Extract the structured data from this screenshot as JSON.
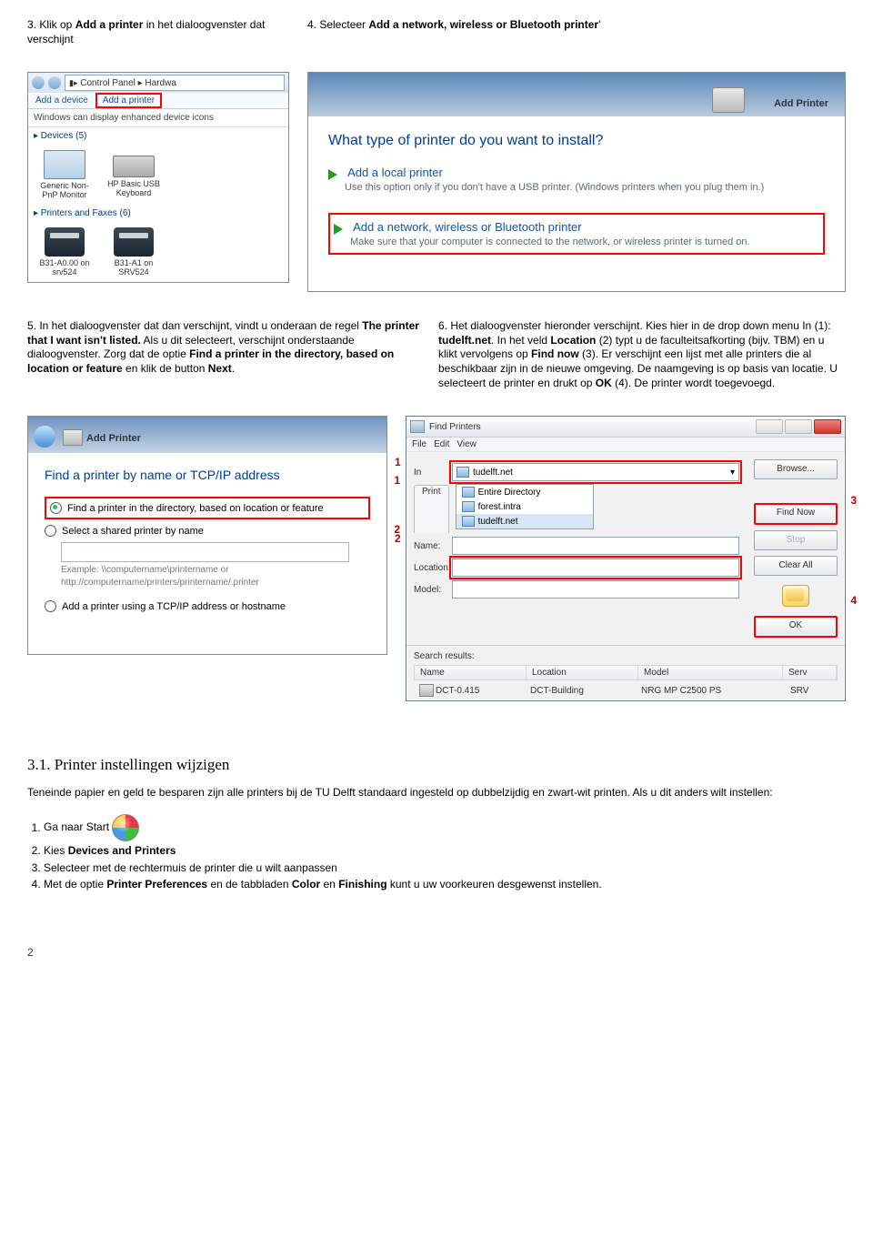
{
  "step3": {
    "text_pre": "3. Klik op ",
    "bold": "Add a printer",
    "text_post": " in het dialoogvenster dat verschijnt"
  },
  "step4": {
    "text_pre": "4. Selecteer ",
    "bold": "Add a network, wireless or Bluetooth printer",
    "text_post": "'"
  },
  "scr1": {
    "breadcrumb": "Control Panel  ▸  Hardwa",
    "tab_add_device": "Add a device",
    "tab_add_printer": "Add a printer",
    "hint": "Windows can display enhanced device icons",
    "section_devices": "▸ Devices (5)",
    "dev_monitor": "Generic Non-PnP Monitor",
    "dev_keyboard": "HP Basic USB Keyboard",
    "section_printers": "▸ Printers and Faxes (6)",
    "prn1": "B31-A0.00 on srv524",
    "prn2": "B31-A1 on SRV524"
  },
  "scr2": {
    "header": "Add Printer",
    "title": "What type of printer do you want to install?",
    "opt1_label": "Add a local printer",
    "opt1_desc": "Use this option only if you don't have a USB printer. (Windows printers when you plug them in.)",
    "opt2_label": "Add a network, wireless or Bluetooth printer",
    "opt2_desc": "Make sure that your computer is connected to the network, or wireless printer is turned on."
  },
  "step5": {
    "pre": "5. In het dialoogvenster dat dan verschijnt, vindt u onderaan de regel ",
    "b1": "The printer that I want isn't listed.",
    "mid1": " Als u dit selecteert, verschijnt onderstaande dialoogvenster. Zorg dat de optie ",
    "b2": "Find a printer in the directory, based on location or feature",
    "mid2": " en klik de button ",
    "b3": "Next",
    "end": "."
  },
  "step6": {
    "pre": "6. Het dialoogvenster hieronder verschijnt. Kies hier in de drop down menu In (1): ",
    "b1": "tudelft.net",
    "mid1": ". In het veld ",
    "b2": "Location",
    "mid2": " (2) typt u de faculteitsafkorting (bijv. TBM) en u klikt vervolgens op ",
    "b3": "Find now",
    "mid3": " (3). Er verschijnt een lijst met alle printers die al beschikbaar zijn in de nieuwe omgeving. De naamgeving is op basis van locatie. U selecteert de printer en drukt op ",
    "b4": "OK",
    "end": " (4). De printer wordt toegevoegd."
  },
  "scr3": {
    "header": "Add Printer",
    "title": "Find a printer by name or TCP/IP address",
    "opt1": "Find a printer in the directory, based on location or feature",
    "opt2": "Select a shared printer by name",
    "example": "Example: \\\\computername\\printername or http://computername/printers/printername/.printer",
    "opt3": "Add a printer using a TCP/IP address or hostname",
    "num1": "1",
    "num2": "2"
  },
  "scr4": {
    "title": "Find Printers",
    "menu_file": "File",
    "menu_edit": "Edit",
    "menu_view": "View",
    "in_label": "In",
    "in_value": "tudelft.net",
    "tab_printers": "Print",
    "dd_entire": "Entire Directory",
    "dd_forest": "forest.intra",
    "dd_tudelft": "tudelft.net",
    "name_label": "Name:",
    "loc_label": "Location:",
    "model_label": "Model:",
    "btn_browse": "Browse...",
    "btn_findnow": "Find Now",
    "btn_stop": "Stop",
    "btn_clear": "Clear All",
    "btn_ok": "OK",
    "results_label": "Search results:",
    "col_name": "Name",
    "col_location": "Location",
    "col_model": "Model",
    "col_server": "Serv",
    "row_name": "DCT-0.415",
    "row_loc": "DCT-Building",
    "row_model": "NRG MP C2500 PS",
    "row_srv": "SRV",
    "num1": "1",
    "num2": "2",
    "num3": "3",
    "num4": "4"
  },
  "section31_title": "3.1. Printer instellingen wijzigen",
  "section31_para": "Teneinde papier en geld te besparen zijn alle printers bij de TU Delft standaard ingesteld op dubbelzijdig en zwart-wit printen. Als u dit anders wilt instellen:",
  "steps31": {
    "s1": "Ga naar Start",
    "s2_pre": "Kies ",
    "s2_b": "Devices and Printers",
    "s3": "Selecteer met de rechtermuis de printer die u wilt aanpassen",
    "s4_pre": "Met de optie ",
    "s4_b1": "Printer Preferences",
    "s4_mid1": " en de tabbladen ",
    "s4_b2": "Color",
    "s4_mid2": " en ",
    "s4_b3": "Finishing",
    "s4_end": " kunt u uw voorkeuren desgewenst instellen."
  },
  "pagenum": "2"
}
